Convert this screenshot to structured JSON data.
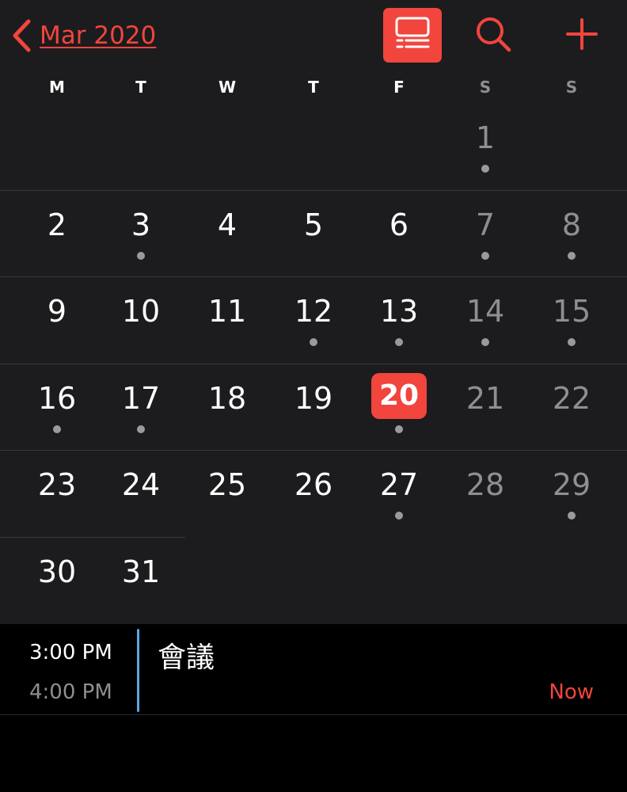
{
  "header": {
    "month_label": "Mar 2020",
    "icons": [
      "chevron-left-icon",
      "list-view-icon",
      "search-icon",
      "plus-icon"
    ],
    "accent_color": "#f1453d"
  },
  "weekdays": [
    "M",
    "T",
    "W",
    "T",
    "F",
    "S",
    "S"
  ],
  "calendar": {
    "weeks": [
      [
        null,
        null,
        null,
        null,
        null,
        {
          "day": "1",
          "dot": true,
          "weekend": true
        },
        null
      ],
      [
        {
          "day": "2"
        },
        {
          "day": "3",
          "dot": true
        },
        {
          "day": "4"
        },
        {
          "day": "5"
        },
        {
          "day": "6"
        },
        {
          "day": "7",
          "dot": true,
          "weekend": true
        },
        {
          "day": "8",
          "dot": true,
          "weekend": true
        }
      ],
      [
        {
          "day": "9"
        },
        {
          "day": "10"
        },
        {
          "day": "11"
        },
        {
          "day": "12",
          "dot": true
        },
        {
          "day": "13",
          "dot": true
        },
        {
          "day": "14",
          "dot": true,
          "weekend": true
        },
        {
          "day": "15",
          "dot": true,
          "weekend": true
        }
      ],
      [
        {
          "day": "16",
          "dot": true
        },
        {
          "day": "17",
          "dot": true
        },
        {
          "day": "18"
        },
        {
          "day": "19"
        },
        {
          "day": "20",
          "dot": true,
          "today": true
        },
        {
          "day": "21",
          "weekend": true
        },
        {
          "day": "22",
          "weekend": true
        }
      ],
      [
        {
          "day": "23"
        },
        {
          "day": "24"
        },
        {
          "day": "25"
        },
        {
          "day": "26"
        },
        {
          "day": "27",
          "dot": true
        },
        {
          "day": "28",
          "weekend": true
        },
        {
          "day": "29",
          "dot": true,
          "weekend": true
        }
      ],
      [
        {
          "day": "30"
        },
        {
          "day": "31"
        },
        null,
        null,
        null,
        null,
        null
      ]
    ]
  },
  "event": {
    "start_time": "3:00 PM",
    "end_time": "4:00 PM",
    "title": "會議",
    "status": "Now",
    "calendar_color": "#5aa7e4"
  }
}
